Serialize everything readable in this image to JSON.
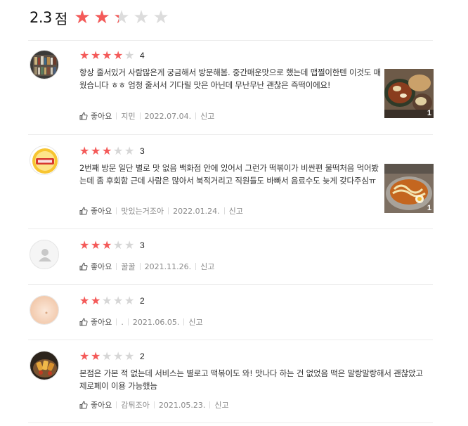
{
  "summary": {
    "score": "2.3",
    "unit": "점",
    "rating": 2.3,
    "max": 5
  },
  "colors": {
    "star_on": "#f45a59",
    "star_off": "#d6d6d6"
  },
  "like_label": "좋아요",
  "report_label": "신고",
  "reviews": [
    {
      "rating": 4,
      "rating_text": "4",
      "text": "항상 줄서있거 사람많은게 궁금해서 방문해봄. 중간매운맛으로 했는데 맵찔이한텐 이것도 매웠습니다 ㅎㅎ 엄청 줄서서 기다릴 맛은 아닌데 무난무난 괜찮은 즉떡이에요!",
      "author": "지민",
      "date": "2022.07.04.",
      "photo_count": "1",
      "avatar_icon": "bookshelf-photo",
      "photo_icon": "tteokbokki-photo"
    },
    {
      "rating": 3,
      "rating_text": "3",
      "text": "2번째 방문 일단 별로 맛 없음 백화점 안에 있어서 그런가 떡볶이가 비싼편 물떡처음 먹어봤는데 좀 후회함 근데 사람은 많아서 북적거리고 직원들도 바빠서 음료수도 늦게 갖다주심ㅠ",
      "author": "맛있는거조아",
      "date": "2022.01.24.",
      "photo_count": "1",
      "avatar_icon": "badge-logo",
      "photo_icon": "ramen-tteokbokki-photo"
    },
    {
      "rating": 3,
      "rating_text": "3",
      "text": "",
      "author": "꿀꿀",
      "date": "2021.11.26.",
      "avatar_icon": "default-user-icon"
    },
    {
      "rating": 2,
      "rating_text": "2",
      "text": "",
      "author": ".",
      "date": "2021.06.05.",
      "avatar_icon": "peach-photo"
    },
    {
      "rating": 2,
      "rating_text": "2",
      "text": "본점은 가본 적 없는데 서비스는 별로고 떡볶이도 와! 맛나다 하는 건 없었음 떡은 말랑말랑해서 괜찮았고 제로페이 이용 가능했늠",
      "author": "감튀조아",
      "date": "2021.05.23.",
      "avatar_icon": "fried-food-photo"
    }
  ]
}
